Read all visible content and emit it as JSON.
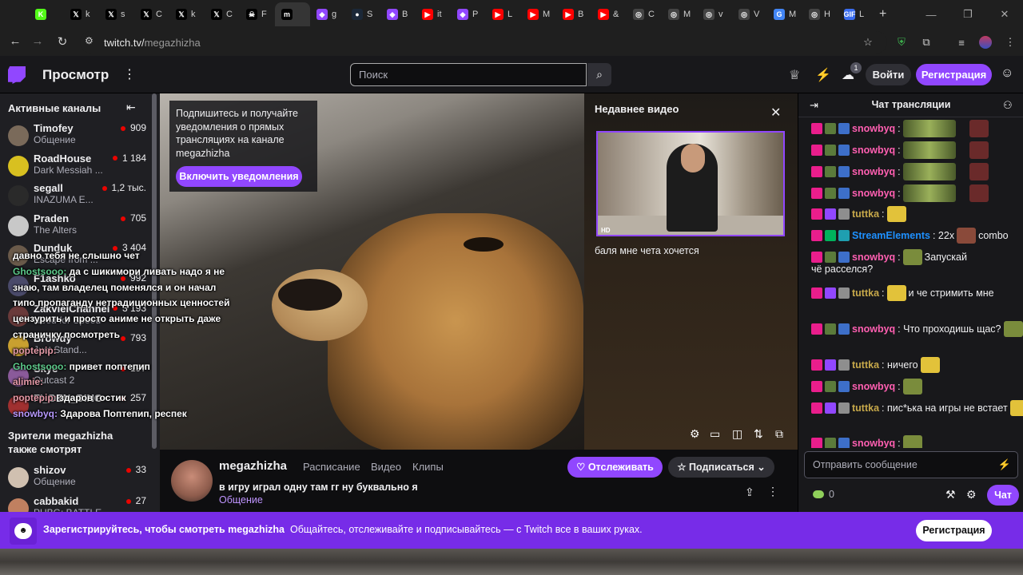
{
  "browser": {
    "tabs": [
      {
        "icon": "K",
        "label": "",
        "color": "#53fc18"
      },
      {
        "icon": "𝕏",
        "label": "k",
        "color": "#000"
      },
      {
        "icon": "𝕏",
        "label": "s",
        "color": "#000"
      },
      {
        "icon": "𝕏",
        "label": "C",
        "color": "#000"
      },
      {
        "icon": "𝕏",
        "label": "k",
        "color": "#000"
      },
      {
        "icon": "𝕏",
        "label": "C",
        "color": "#000"
      },
      {
        "icon": "☠",
        "label": "F",
        "color": "#000"
      },
      {
        "icon": "m",
        "label": "",
        "color": "#000",
        "active": true
      },
      {
        "icon": "◆",
        "label": "g",
        "color": "#9147ff"
      },
      {
        "icon": "●",
        "label": "S",
        "color": "#1b2838"
      },
      {
        "icon": "◆",
        "label": "B",
        "color": "#9147ff"
      },
      {
        "icon": "▶",
        "label": "it",
        "color": "#ff0000"
      },
      {
        "icon": "◆",
        "label": "P",
        "color": "#9147ff"
      },
      {
        "icon": "▶",
        "label": "L",
        "color": "#ff0000"
      },
      {
        "icon": "▶",
        "label": "M",
        "color": "#ff0000"
      },
      {
        "icon": "▶",
        "label": "B",
        "color": "#ff0000"
      },
      {
        "icon": "▶",
        "label": "&",
        "color": "#ff0000"
      },
      {
        "icon": "◎",
        "label": "C",
        "color": "#444"
      },
      {
        "icon": "◎",
        "label": "M",
        "color": "#444"
      },
      {
        "icon": "◎",
        "label": "v",
        "color": "#444"
      },
      {
        "icon": "◎",
        "label": "V",
        "color": "#444"
      },
      {
        "icon": "G",
        "label": "M",
        "color": "#4285f4"
      },
      {
        "icon": "◎",
        "label": "H",
        "color": "#444"
      },
      {
        "icon": "GIF",
        "label": "L",
        "color": "#3a6df0"
      }
    ],
    "new_tab": "+",
    "url_host": "twitch.tv/",
    "url_path": "megazhizha"
  },
  "topnav": {
    "browse": "Просмотр",
    "search_placeholder": "Поиск",
    "notif_count": "1",
    "login": "Войти",
    "signup": "Регистрация"
  },
  "sidebar": {
    "title": "Активные каналы",
    "channels": [
      {
        "name": "Timofey",
        "game": "Общение",
        "viewers": "909",
        "avatar": "#7a6a5a"
      },
      {
        "name": "RoadHouse",
        "game": "Dark Messiah ...",
        "viewers": "1 184",
        "avatar": "#d8c020"
      },
      {
        "name": "segall",
        "game": "INAZUMA E...",
        "viewers": "1,2 тыс.",
        "avatar": "#2a2a2a"
      },
      {
        "name": "Praden",
        "game": "The Alters",
        "viewers": "705",
        "avatar": "#c8c8c8"
      },
      {
        "name": "Dunduk",
        "game": "Escape from ...",
        "viewers": "3 404",
        "avatar": "#6a5a4a"
      },
      {
        "name": "F1ashko",
        "game": "",
        "viewers": "992",
        "avatar": "#4a4a6a"
      },
      {
        "name": "ZakvielChannel",
        "game": "Need for Speed",
        "viewers": "3 193",
        "avatar": "#6a3a3a"
      },
      {
        "name": "Browdy",
        "game": "Just Stand...",
        "viewers": "793",
        "avatar": "#c9a030"
      },
      {
        "name": "Skye",
        "game": "Outcast 2",
        "viewers": "197",
        "avatar": "#8a5a9a"
      },
      {
        "name": "FI_DEN_DING",
        "game": "",
        "viewers": "257",
        "avatar": "#a03030"
      }
    ],
    "also_watch": "Зрители megazhizha также смотрят",
    "related": [
      {
        "name": "shizov",
        "game": "Общение",
        "viewers": "33",
        "avatar": "#d0c0b0"
      },
      {
        "name": "cabbakid",
        "game": "PUBG: BATTLE...",
        "viewers": "27",
        "avatar": "#c08060"
      }
    ]
  },
  "player": {
    "notif_text": "Подпишитесь и получайте уведомления о прямых трансляциях на канале megazhizha",
    "notif_button": "Включить уведомления",
    "recent_title": "Недавнее видео",
    "thumb_badge": "HD",
    "recent_video_title": "баля мне чета хочется",
    "overlay_chat": [
      {
        "user": "",
        "text": "давно тебя не слышно чет"
      },
      {
        "user": "Ghostsooo:",
        "text": "да с шикимори ливать надо я не знаю, там владелец поменялся и он начал типо пропаганду нетрадиционных ценностей цензурить и просто аниме не открыть даже страничку посмотреть"
      },
      {
        "user": "poptepip:",
        "text": ""
      },
      {
        "user": "Ghostsooo:",
        "text": "привет поптепип"
      },
      {
        "user": "alimie:",
        "text": ""
      },
      {
        "user": "poptepip:",
        "text": "здаров гостик"
      },
      {
        "user": "snowbyq:",
        "text": "Здарова Поптепип, респек"
      }
    ]
  },
  "info": {
    "channel": "megazhizha",
    "tabs": [
      "Расписание",
      "Видео",
      "Клипы"
    ],
    "title": "в игру играл одну там гг ну буквально я",
    "category": "Общение",
    "follow": "Отслеживать",
    "subscribe": "Подписаться"
  },
  "chat": {
    "title": "Чат трансляции",
    "messages": [
      {
        "user": "snowbyq",
        "color": "#ff5fb1",
        "text": ":",
        "extra": ""
      },
      {
        "user": "snowbyq",
        "color": "#ff5fb1",
        "text": ":",
        "extra": ""
      },
      {
        "user": "snowbyq",
        "color": "#ff5fb1",
        "text": ":",
        "extra": ""
      },
      {
        "user": "snowbyq",
        "color": "#ff5fb1",
        "text": ":",
        "extra": ""
      },
      {
        "user": "tuttka",
        "color": "#c6a84a",
        "text": ":",
        "extra": ""
      },
      {
        "user": "StreamElements",
        "color": "#1e90ff",
        "text": ": 22x",
        "extra": "combo"
      },
      {
        "user": "snowbyq",
        "color": "#ff5fb1",
        "text": ":",
        "extra": "Запускай"
      },
      {
        "user": "",
        "color": "#efeff1",
        "text": "чё расселся?",
        "extra": ""
      },
      {
        "user": "tuttka",
        "color": "#c6a84a",
        "text": ":",
        "extra": "и че стримить мне"
      },
      {
        "user": "snowbyq",
        "color": "#ff5fb1",
        "text": ": Что проходишь щас?",
        "extra": ""
      },
      {
        "user": "tuttka",
        "color": "#c6a84a",
        "text": ": ничего",
        "extra": ""
      },
      {
        "user": "snowbyq",
        "color": "#ff5fb1",
        "text": ":",
        "extra": ""
      },
      {
        "user": "tuttka",
        "color": "#c6a84a",
        "text": ": пис*ька на игры не встает",
        "extra": ""
      },
      {
        "user": "snowbyq",
        "color": "#ff5fb1",
        "text": ":",
        "extra": ""
      }
    ],
    "input_placeholder": "Отправить сообщение",
    "points": "0",
    "send": "Чат"
  },
  "banner": {
    "lead": "Зарегистрируйтесь, чтобы смотреть megazhizha",
    "rest": "Общайтесь, отслеживайте и подписывайтесь — с Twitch все в ваших руках.",
    "button": "Регистрация"
  },
  "colors": {
    "accent": "#9147ff",
    "banner": "#772ce8",
    "live": "#eb0400"
  }
}
